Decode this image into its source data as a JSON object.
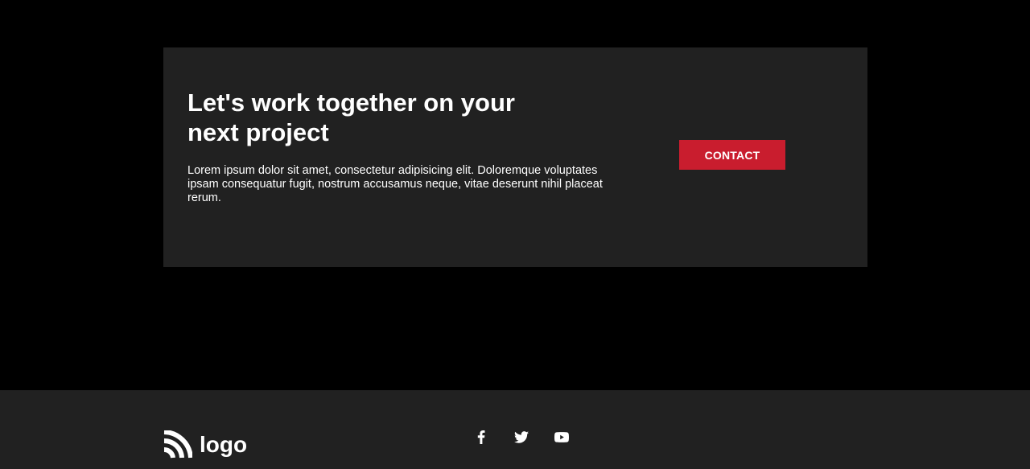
{
  "cta": {
    "heading": "Let's work together on your next project",
    "body": "Lorem ipsum dolor sit amet, consectetur adipisicing elit. Doloremque voluptates ipsam consequatur fugit, nostrum accusamus neque, vitae deserunt nihil placeat rerum.",
    "button_label": "CONTACT"
  },
  "footer": {
    "logo_text": "logo",
    "social": [
      {
        "name": "facebook-icon"
      },
      {
        "name": "twitter-icon"
      },
      {
        "name": "youtube-icon"
      }
    ]
  },
  "colors": {
    "page_background": "#000000",
    "card_background": "#212121",
    "accent": "#c91d2e",
    "text": "#ffffff"
  }
}
